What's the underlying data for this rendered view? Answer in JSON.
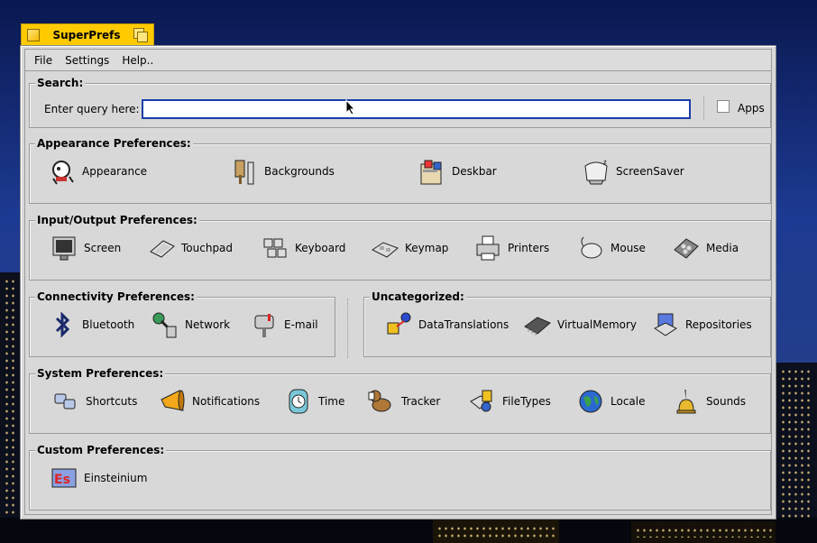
{
  "window": {
    "title": "SuperPrefs"
  },
  "menu": [
    "File",
    "Settings",
    "Help.."
  ],
  "search": {
    "title": "Search:",
    "query_label": "Enter query here:",
    "query_value": "",
    "apps_label": "Apps",
    "apps_checked": false
  },
  "appearance": {
    "title": "Appearance Preferences:",
    "items": [
      {
        "label": "Appearance",
        "icon": "appearance-icon"
      },
      {
        "label": "Backgrounds",
        "icon": "backgrounds-icon"
      },
      {
        "label": "Deskbar",
        "icon": "deskbar-icon"
      },
      {
        "label": "ScreenSaver",
        "icon": "screensaver-icon"
      }
    ]
  },
  "io": {
    "title": "Input/Output Preferences:",
    "items": [
      {
        "label": "Screen",
        "icon": "screen-icon"
      },
      {
        "label": "Touchpad",
        "icon": "touchpad-icon"
      },
      {
        "label": "Keyboard",
        "icon": "keyboard-icon"
      },
      {
        "label": "Keymap",
        "icon": "keymap-icon"
      },
      {
        "label": "Printers",
        "icon": "printer-icon"
      },
      {
        "label": "Mouse",
        "icon": "mouse-icon"
      },
      {
        "label": "Media",
        "icon": "media-icon"
      }
    ]
  },
  "connectivity": {
    "title": "Connectivity Preferences:",
    "items": [
      {
        "label": "Bluetooth",
        "icon": "bluetooth-icon"
      },
      {
        "label": "Network",
        "icon": "network-icon"
      },
      {
        "label": "E-mail",
        "icon": "email-icon"
      }
    ]
  },
  "uncategorized": {
    "title": "Uncategorized:",
    "items": [
      {
        "label": "DataTranslations",
        "icon": "datatranslations-icon"
      },
      {
        "label": "VirtualMemory",
        "icon": "memory-chip-icon"
      },
      {
        "label": "Repositories",
        "icon": "repositories-icon"
      }
    ]
  },
  "system": {
    "title": "System Preferences:",
    "items": [
      {
        "label": "Shortcuts",
        "icon": "shortcuts-icon"
      },
      {
        "label": "Notifications",
        "icon": "megaphone-icon"
      },
      {
        "label": "Time",
        "icon": "clock-icon"
      },
      {
        "label": "Tracker",
        "icon": "dog-icon"
      },
      {
        "label": "FileTypes",
        "icon": "filetypes-icon"
      },
      {
        "label": "Locale",
        "icon": "globe-icon"
      },
      {
        "label": "Sounds",
        "icon": "bell-icon"
      }
    ]
  },
  "custom": {
    "title": "Custom Preferences:",
    "items": [
      {
        "label": "Einsteinium",
        "icon": "einsteinium-icon"
      }
    ]
  },
  "colors": {
    "tab_yellow": "#ffcb00",
    "panel_gray": "#d8d8d8",
    "focus_blue": "#1a3fa8"
  }
}
